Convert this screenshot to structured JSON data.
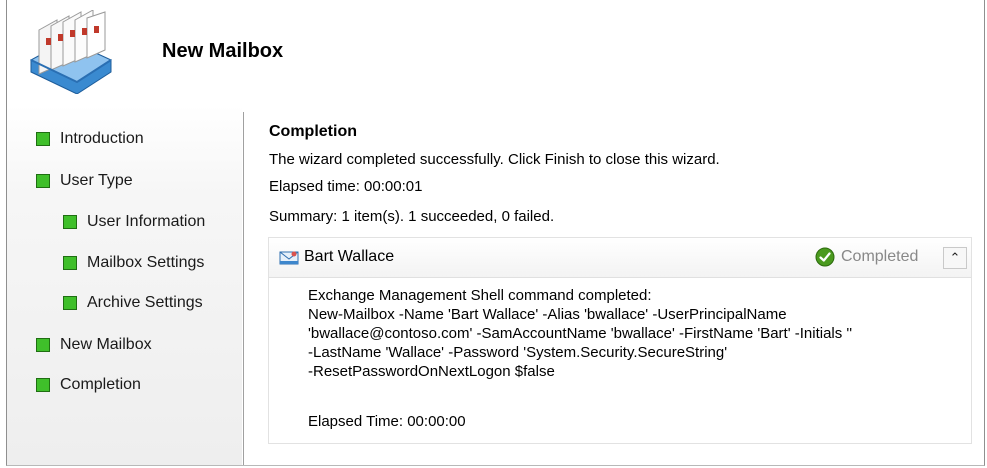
{
  "header": {
    "title": "New Mailbox"
  },
  "sidebar": {
    "items": [
      {
        "label": "Introduction"
      },
      {
        "label": "User Type"
      },
      {
        "label": "User Information"
      },
      {
        "label": "Mailbox Settings"
      },
      {
        "label": "Archive Settings"
      },
      {
        "label": "New Mailbox"
      },
      {
        "label": "Completion"
      }
    ]
  },
  "main": {
    "heading": "Completion",
    "message": "The wizard completed successfully. Click Finish to close this wizard.",
    "elapsed": "Elapsed time: 00:00:01",
    "summary": "Summary: 1 item(s). 1 succeeded, 0 failed."
  },
  "result": {
    "name": "Bart Wallace",
    "status": "Completed",
    "command_lines": [
      "Exchange Management Shell command completed:",
      "New-Mailbox -Name 'Bart Wallace' -Alias 'bwallace' -UserPrincipalName",
      "'bwallace@contoso.com' -SamAccountName 'bwallace' -FirstName 'Bart' -Initials ''",
      "-LastName 'Wallace' -Password 'System.Security.SecureString'",
      "-ResetPasswordOnNextLogon $false"
    ],
    "elapsed": "Elapsed Time: 00:00:00"
  },
  "colors": {
    "bullet": "#3fbf2a",
    "status_check": "#4a9a1e"
  },
  "icons": {
    "header": "mailbox-stack-icon",
    "result": "mailbox-user-icon",
    "status": "checkmark-icon",
    "collapse": "double-chevron-up-icon"
  }
}
